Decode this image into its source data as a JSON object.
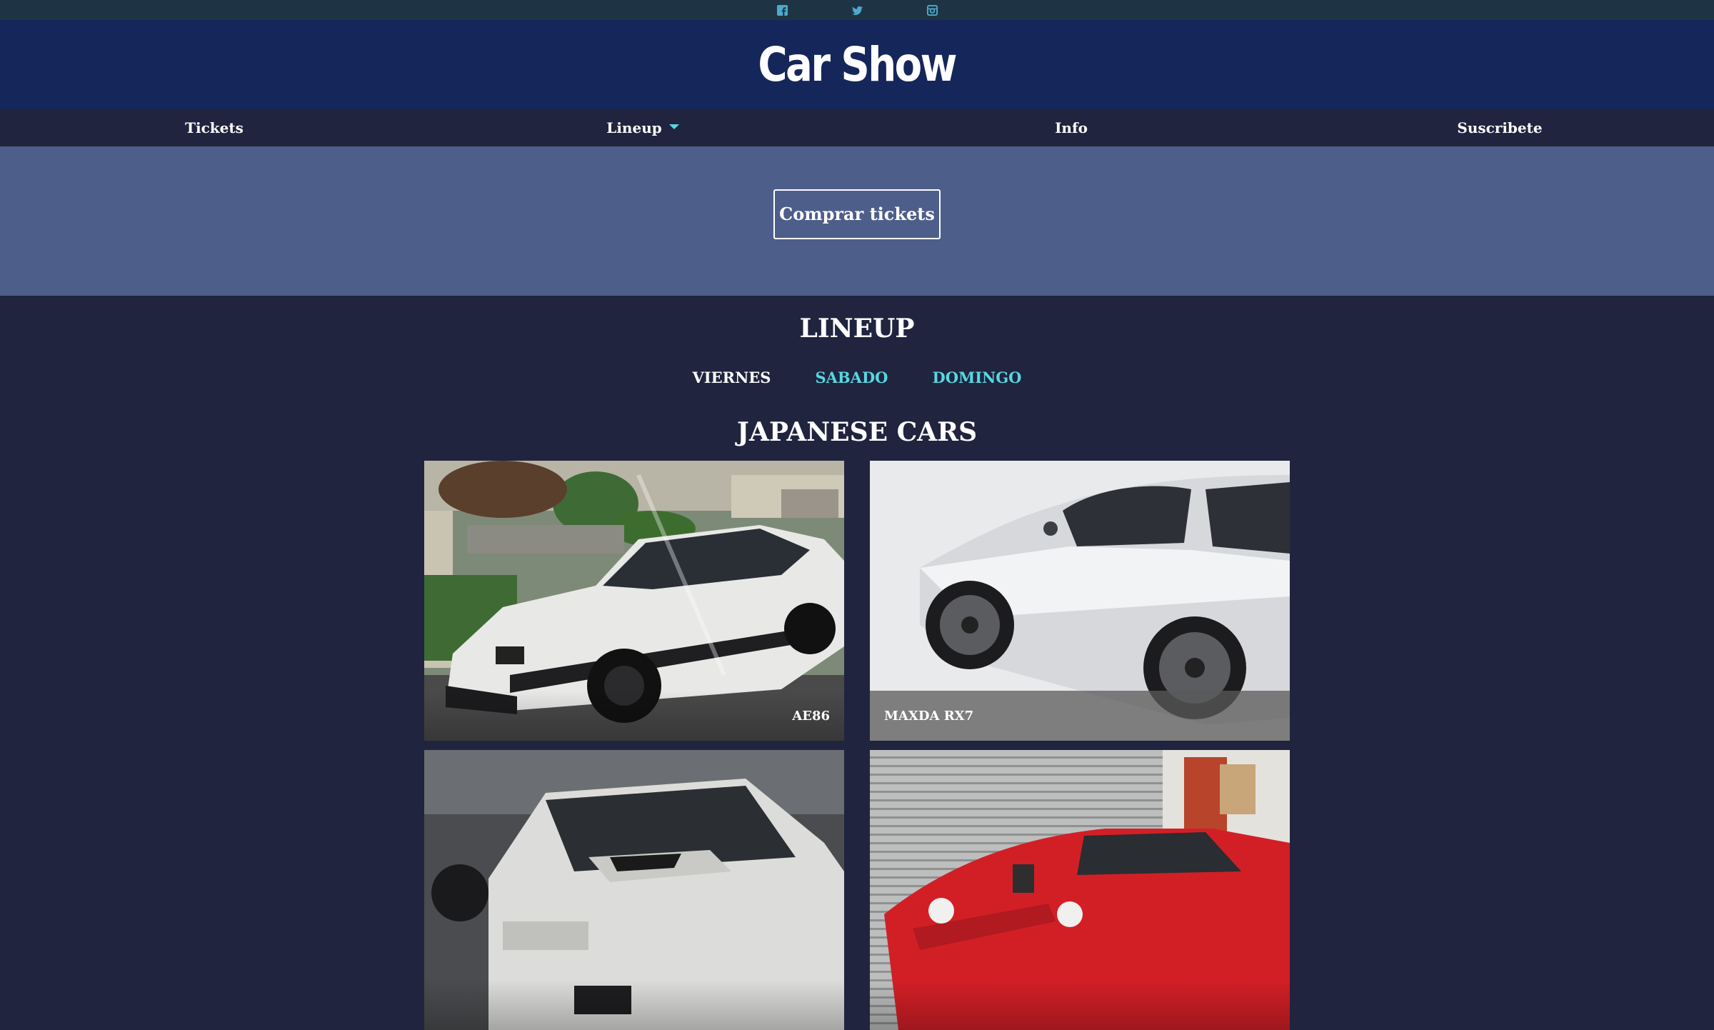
{
  "social": {
    "items": [
      {
        "icon": "facebook-icon"
      },
      {
        "icon": "twitter-icon"
      },
      {
        "icon": "instagram-icon"
      }
    ],
    "icon_color": "#4fa9c9"
  },
  "header": {
    "title": "Car Show"
  },
  "nav": {
    "items": [
      {
        "label": "Tickets"
      },
      {
        "label": "Lineup",
        "has_dropdown": true
      },
      {
        "label": "Info"
      },
      {
        "label": "Suscribete"
      }
    ]
  },
  "hero": {
    "button_label": "Comprar tickets"
  },
  "lineup": {
    "title": "LINEUP",
    "days": [
      {
        "label": "VIERNES",
        "active": true
      },
      {
        "label": "SABADO",
        "active": false
      },
      {
        "label": "DOMINGO",
        "active": false
      }
    ],
    "category_title": "JAPANESE CARS",
    "cars": [
      {
        "name": "AE86"
      },
      {
        "name": "MAXDA RX7"
      },
      {
        "name": ""
      },
      {
        "name": ""
      }
    ]
  },
  "colors": {
    "social_bar": "#1e3445",
    "banner": "#15275a",
    "navbar": "#20243f",
    "hero": "#4e5e8a",
    "page_background": "#20243f",
    "accent": "#58d7e0"
  }
}
